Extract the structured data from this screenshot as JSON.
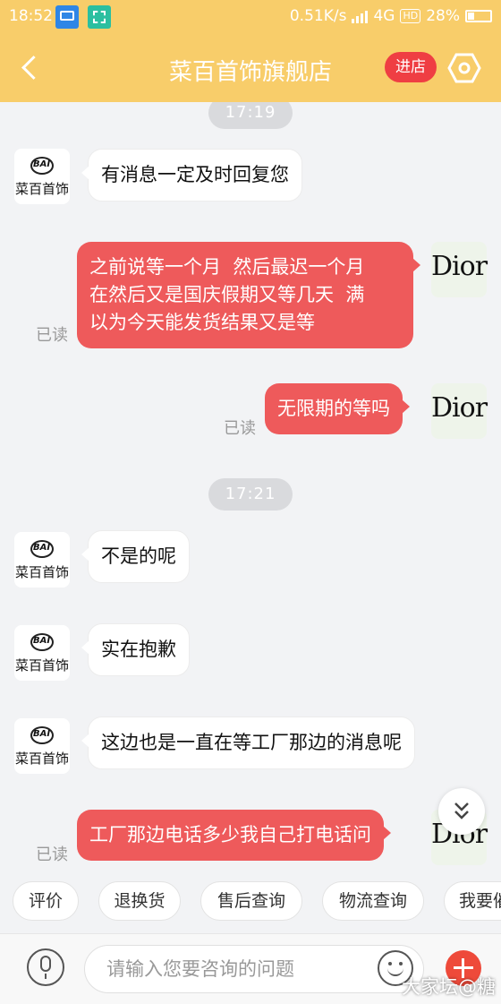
{
  "status_bar": {
    "time": "18:52",
    "net_speed": "0.51K/s",
    "network": "4G",
    "hd": "HD",
    "battery": "28%",
    "battery_level": 0.28
  },
  "header": {
    "title": "菜百首饰旗舰店",
    "enter_shop": "进店"
  },
  "shop_name": "菜百首饰",
  "user_avatar_text": "Dior",
  "timestamps": [
    "17:19",
    "17:21"
  ],
  "messages": [
    {
      "from": "shop",
      "text": "有消息一定及时回复您"
    },
    {
      "from": "user",
      "lines": [
        "之前说等一个月  然后最迟一个月",
        "在然后又是国庆假期又等几天  满",
        "以为今天能发货结果又是等"
      ],
      "status": "已读"
    },
    {
      "from": "user",
      "text": "无限期的等吗",
      "status": "已读"
    },
    {
      "from": "shop",
      "text": "不是的呢"
    },
    {
      "from": "shop",
      "text": "实在抱歉"
    },
    {
      "from": "shop",
      "text": "这边也是一直在等工厂那边的消息呢"
    },
    {
      "from": "user",
      "text": "工厂那边电话多少我自己打电话问",
      "status": "已读"
    }
  ],
  "quick_replies": [
    "评价",
    "退换货",
    "售后查询",
    "物流查询",
    "我要催"
  ],
  "input": {
    "placeholder": "请输入您要咨询的问题"
  },
  "watermark": "大家坛@糖"
}
